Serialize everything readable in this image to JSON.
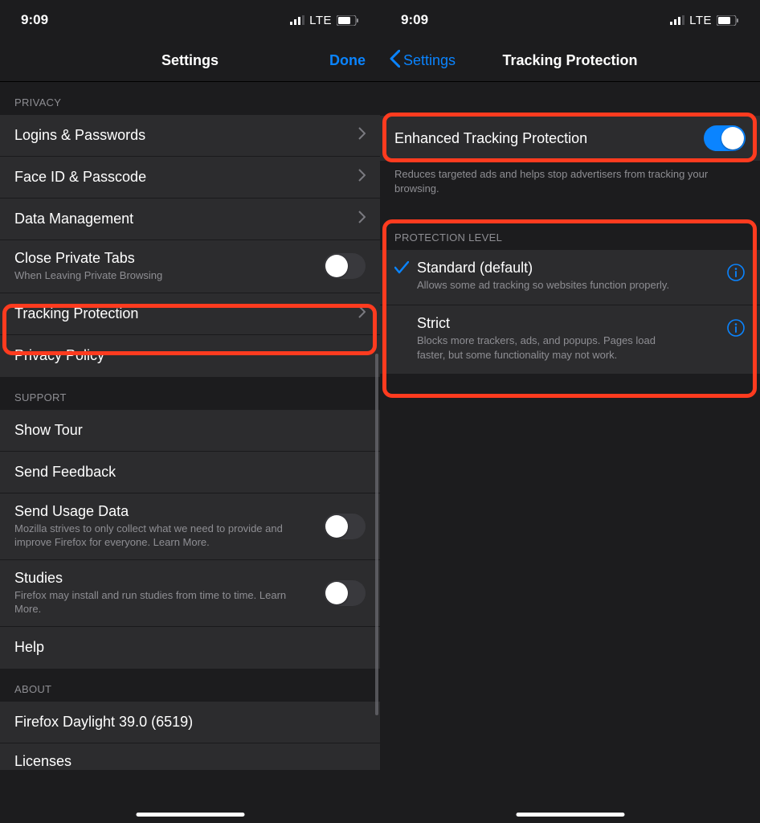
{
  "status": {
    "time": "9:09",
    "net": "LTE"
  },
  "left": {
    "nav": {
      "title": "Settings",
      "done": "Done"
    },
    "sections": {
      "privacy": {
        "header": "PRIVACY",
        "rows": {
          "logins": {
            "label": "Logins & Passwords"
          },
          "faceid": {
            "label": "Face ID & Passcode"
          },
          "datamgmt": {
            "label": "Data Management"
          },
          "closetabs": {
            "label": "Close Private Tabs",
            "sub": "When Leaving Private Browsing"
          },
          "tracking": {
            "label": "Tracking Protection"
          },
          "privacypolicy": {
            "label": "Privacy Policy"
          }
        }
      },
      "support": {
        "header": "SUPPORT",
        "rows": {
          "tour": {
            "label": "Show Tour"
          },
          "feedback": {
            "label": "Send Feedback"
          },
          "usage": {
            "label": "Send Usage Data",
            "sub": "Mozilla strives to only collect what we need to provide and improve Firefox for everyone. Learn More."
          },
          "studies": {
            "label": "Studies",
            "sub": "Firefox may install and run studies from time to time. Learn More."
          },
          "help": {
            "label": "Help"
          }
        }
      },
      "about": {
        "header": "ABOUT",
        "rows": {
          "version": {
            "label": "Firefox Daylight 39.0 (6519)"
          },
          "licenses": {
            "label": "Licenses"
          }
        }
      }
    }
  },
  "right": {
    "nav": {
      "back": "Settings",
      "title": "Tracking Protection"
    },
    "etp": {
      "label": "Enhanced Tracking Protection",
      "footer": "Reduces targeted ads and helps stop advertisers from tracking your browsing."
    },
    "level": {
      "header": "PROTECTION LEVEL",
      "options": {
        "standard": {
          "title": "Standard (default)",
          "desc": "Allows some ad tracking so websites function properly."
        },
        "strict": {
          "title": "Strict",
          "desc": "Blocks more trackers, ads, and popups. Pages load faster, but some functionality may not work."
        }
      }
    }
  }
}
